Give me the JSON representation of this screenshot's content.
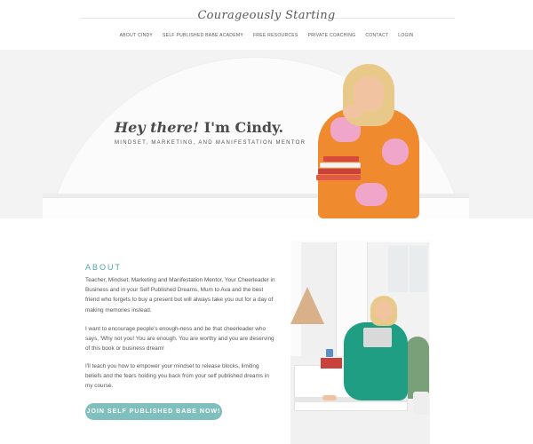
{
  "header": {
    "logo_text": "Courageously Starting",
    "nav": [
      {
        "label": "ABOUT CINDY"
      },
      {
        "label": "SELF PUBLISHED BABE ACADEMY"
      },
      {
        "label": "FREE RESOURCES"
      },
      {
        "label": "PRIVATE COACHING"
      },
      {
        "label": "CONTACT"
      },
      {
        "label": "LOGIN"
      }
    ]
  },
  "hero": {
    "greeting": "Hey there!",
    "name_text": "I'm Cindy.",
    "subtitle": "MINDSET, MARKETING, AND MANIFESTATION MENTOR"
  },
  "about": {
    "heading": "ABOUT",
    "paragraphs": [
      "Teacher, Mindset, Marketing and Manifestation Mentor, Your Cheerleader in Business and in your Self Published Dreams, Mum to Ava and the best friend who forgets to buy a present but will always take you out for a day of making memories instead.",
      " I want to encourage people's enough-ness and be that cheerleader who says, 'Why not you! You are enough. You are worthy and you are deserving of this book or business dream!",
      "I'll teach you how to empower your mindset to release blocks, limiting beliefs and the fears holding you back from your self published dreams in my course."
    ],
    "cta_label": "JOIN SELF PUBLISHED BABE NOW!"
  },
  "colors": {
    "accent": "#4aa5b0",
    "button": "#7fbfbd"
  }
}
